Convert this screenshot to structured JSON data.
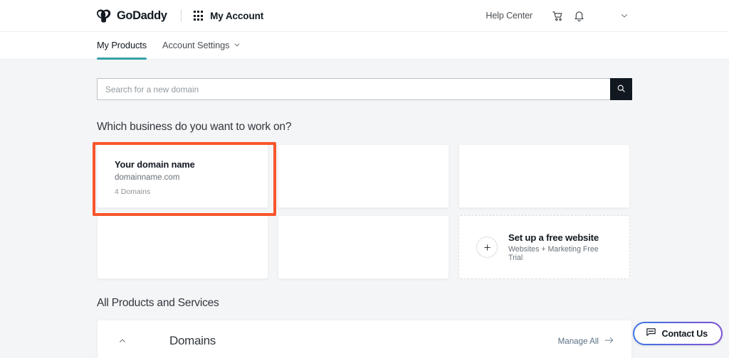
{
  "header": {
    "brand_name": "GoDaddy",
    "brand_mark_icon": "godaddy-logo-icon",
    "app_launcher_icon": "grid-9-dots-icon",
    "account_label": "My Account",
    "help_center_label": "Help Center",
    "cart_icon": "shopping-cart-icon",
    "notifications_icon": "bell-icon",
    "profile_caret_icon": "chevron-down-icon"
  },
  "tabs": [
    {
      "label": "My Products",
      "active": true
    },
    {
      "label": "Account Settings",
      "active": false,
      "caret_icon": "chevron-down-icon"
    }
  ],
  "search": {
    "placeholder": "Search for a new domain",
    "value": "",
    "button_icon": "search-icon"
  },
  "business_section": {
    "heading": "Which business do you want to work on?",
    "cards": [
      {
        "name": "Your domain name",
        "domain": "domainname.com",
        "count": "4 Domains",
        "highlighted": true
      },
      {
        "name": "",
        "domain": "",
        "count": "",
        "highlighted": false
      },
      {
        "name": "",
        "domain": "",
        "count": "",
        "highlighted": false
      },
      {
        "name": "",
        "domain": "",
        "count": "",
        "highlighted": false
      },
      {
        "name": "",
        "domain": "",
        "count": "",
        "highlighted": false
      }
    ],
    "promo": {
      "title": "Set up a free website",
      "subtitle": "Websites + Marketing Free Trial",
      "icon": "plus-circle-icon"
    }
  },
  "products_section": {
    "heading": "All Products and Services",
    "panel": {
      "collapse_icon": "chevron-up-icon",
      "title": "Domains",
      "manage_all_label": "Manage All",
      "manage_all_icon": "arrow-right-icon"
    }
  },
  "contact_widget": {
    "label": "Contact Us",
    "icon": "chat-bubble-icon"
  },
  "colors": {
    "accent_teal": "#35a1a5",
    "annotation_orange": "#f9552b",
    "page_background": "#f4f5f7",
    "gradient_start": "#3d77e8",
    "gradient_end": "#7b52d3",
    "search_button": "#111820"
  }
}
